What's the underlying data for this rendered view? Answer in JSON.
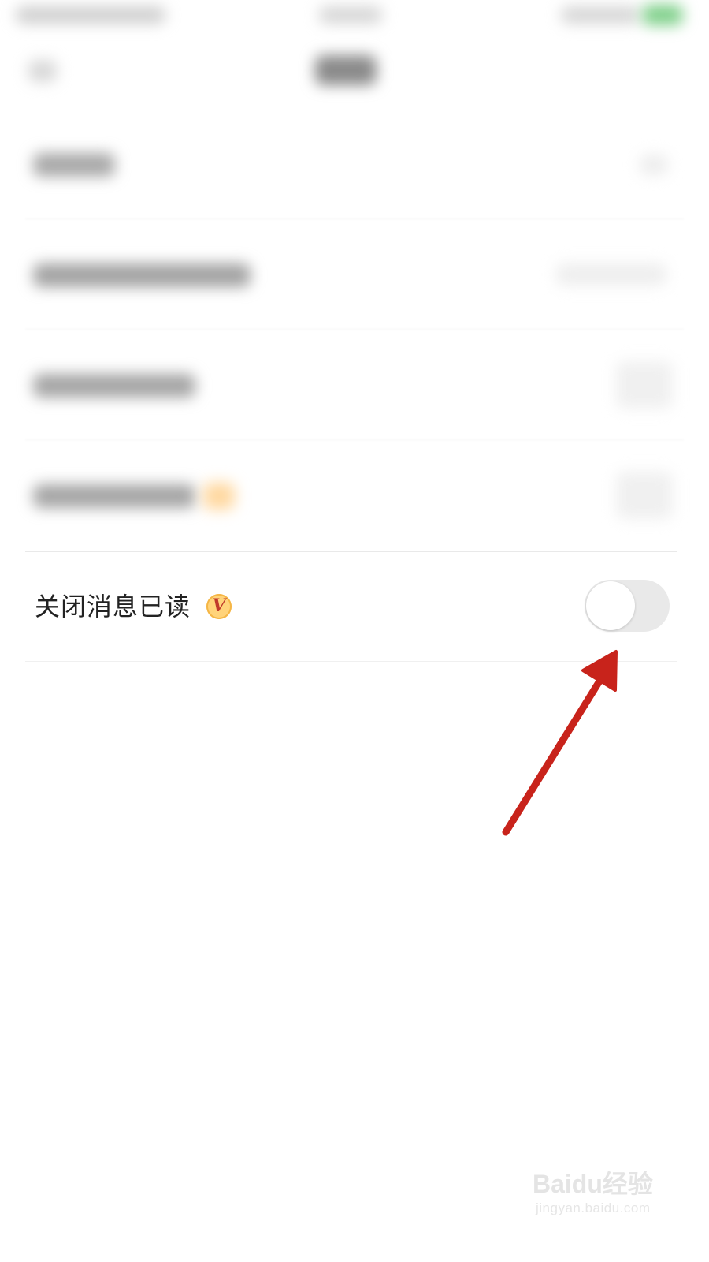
{
  "setting": {
    "label": "关闭消息已读",
    "badge": "V",
    "toggle_on": false
  },
  "colors": {
    "toggle_track_off": "#e9e9e9",
    "badge_fill": "#ffd37a",
    "badge_letter": "#c0392b",
    "annotation_arrow": "#c8231b"
  },
  "watermark": {
    "main": "Baidu经验",
    "sub": "jingyan.baidu.com"
  }
}
